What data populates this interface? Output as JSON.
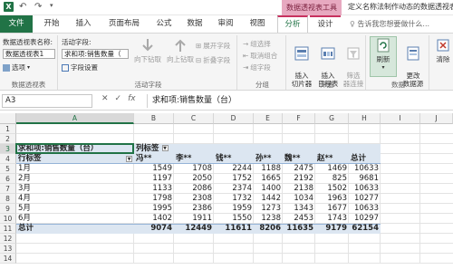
{
  "titlebar": {
    "contextual_title": "数据透视表工具",
    "doc_title": "定义名称法制作动态的数据透视表"
  },
  "tabs": {
    "file": "文件",
    "items": [
      "开始",
      "插入",
      "页面布局",
      "公式",
      "数据",
      "审阅",
      "视图"
    ],
    "contextual": [
      "分析",
      "设计"
    ],
    "tell_me": "告诉我您想要做什么..."
  },
  "ribbon": {
    "pivot": {
      "name_label": "数据透视表名称:",
      "name_value": "数据透视表1",
      "options": "选项",
      "group": "数据透视表"
    },
    "active_field": {
      "label": "活动字段:",
      "value": "求和项:销售数量（",
      "settings": "字段设置",
      "drill_down": "向下钻取",
      "drill_up": "向上钻取",
      "expand": "展开字段",
      "collapse": "折叠字段",
      "group": "活动字段"
    },
    "grouping": {
      "selection": "组选择",
      "ungroup": "取消组合",
      "field": "组字段",
      "group": "分组"
    },
    "filter": {
      "slicer": "插入\n切片器",
      "timeline": "插入\n日程表",
      "connections": "筛选\n器连接",
      "group": "筛选"
    },
    "data": {
      "refresh": "刷新",
      "change_source": "更改\n数据源",
      "group": "数据"
    },
    "clear": "清除"
  },
  "formula_bar": {
    "name_box": "A3",
    "content": "求和项:销售数量（台）"
  },
  "sheet": {
    "columns": [
      "A",
      "B",
      "C",
      "D",
      "E",
      "F",
      "G",
      "H",
      "I",
      "J"
    ],
    "rows": [
      "1",
      "2",
      "3",
      "4",
      "5",
      "6",
      "7",
      "8",
      "9",
      "10",
      "11",
      "12",
      "13",
      "14"
    ],
    "pivot": {
      "value_header": "求和项:销售数量（台）",
      "col_label": "列标签",
      "row_label": "行标签",
      "col_names": [
        "冯**",
        "李**",
        "钱**",
        "孙**",
        "魏**",
        "赵**",
        "总计"
      ],
      "rows": [
        {
          "label": "1月",
          "values": [
            "1549",
            "1708",
            "2244",
            "1188",
            "2475",
            "1469",
            "10633"
          ]
        },
        {
          "label": "2月",
          "values": [
            "1197",
            "2050",
            "1752",
            "1665",
            "2192",
            "825",
            "9681"
          ]
        },
        {
          "label": "3月",
          "values": [
            "1133",
            "2086",
            "2374",
            "1400",
            "2138",
            "1502",
            "10633"
          ]
        },
        {
          "label": "4月",
          "values": [
            "1798",
            "2308",
            "1732",
            "1442",
            "1034",
            "1963",
            "10277"
          ]
        },
        {
          "label": "5月",
          "values": [
            "1995",
            "2386",
            "1959",
            "1273",
            "1343",
            "1677",
            "10633"
          ]
        },
        {
          "label": "6月",
          "values": [
            "1402",
            "1911",
            "1550",
            "1238",
            "2453",
            "1743",
            "10297"
          ]
        }
      ],
      "total": {
        "label": "总计",
        "values": [
          "9074",
          "12449",
          "11611",
          "8206",
          "11635",
          "9179",
          "62154"
        ]
      }
    }
  },
  "colors": {
    "excel_green": "#217346",
    "contextual_pink": "#c7325f",
    "pivot_band": "#dce6f1"
  }
}
